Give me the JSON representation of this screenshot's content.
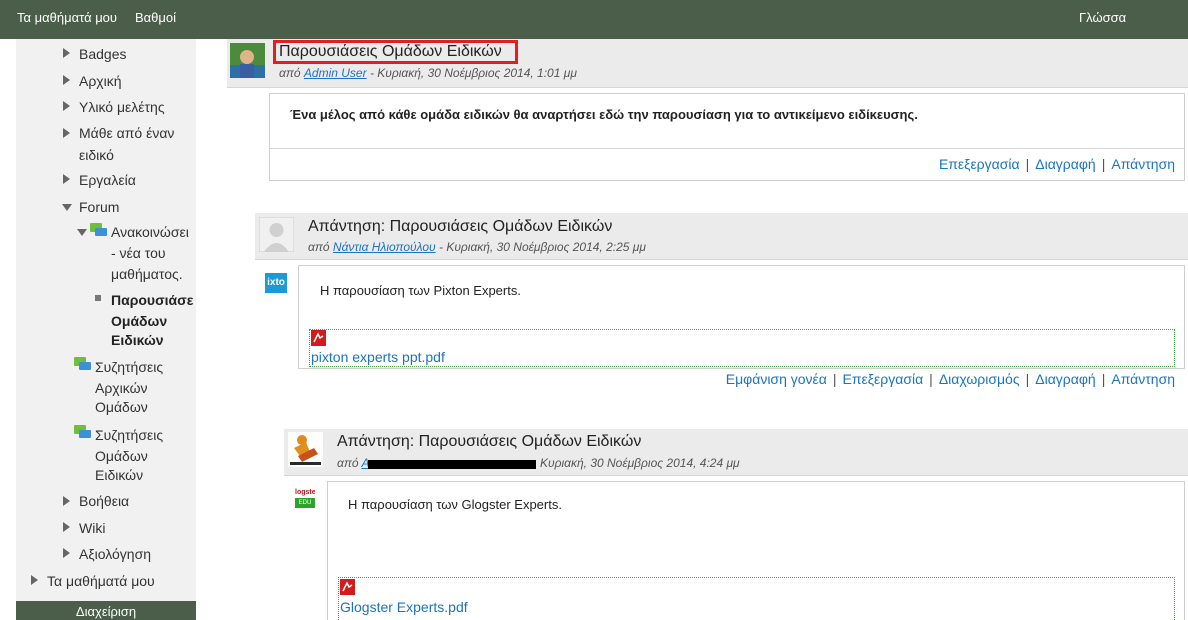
{
  "topnav": {
    "my_courses": "Τα μαθήματά μου",
    "grades": "Βαθμοί",
    "language": "Γλώσσα"
  },
  "sidebar": {
    "items": [
      {
        "label": "Badges"
      },
      {
        "label": "Αρχική"
      },
      {
        "label": "Υλικό μελέτης"
      },
      {
        "label_line1": "Μάθε από έναν",
        "label_line2": "ειδικό"
      },
      {
        "label": "Εργαλεία"
      },
      {
        "label": "Forum"
      }
    ],
    "forum_children": {
      "announcements_line1": "Ανακοινώσει",
      "announcements_line2": "- νέα του",
      "announcements_line3": "μαθήματος.",
      "current_line1": "Παρουσιάσε",
      "current_line2": "Ομάδων",
      "current_line3": "Ειδικών",
      "discussions_initial_line1": "Συζητήσεις",
      "discussions_initial_line2": "Αρχικών",
      "discussions_initial_line3": "Ομάδων",
      "discussions_expert_line1": "Συζητήσεις",
      "discussions_expert_line2": "Ομάδων",
      "discussions_expert_line3": "Ειδικών"
    },
    "bottom_items": [
      {
        "label": "Βοήθεια"
      },
      {
        "label": "Wiki"
      },
      {
        "label": "Αξιολόγηση"
      }
    ],
    "my_courses": "Τα μαθήματά μου",
    "admin": "Διαχείριση"
  },
  "posts": [
    {
      "title": "Παρουσιάσεις Ομάδων Ειδικών",
      "meta_prefix": "από",
      "author": "Admin User",
      "meta_date": "- Κυριακή, 30 Νοέμβριος 2014, 1:01 μμ",
      "body": "Ένα μέλος από κάθε ομάδα ειδικών  θα αναρτήσει εδώ την παρουσίαση για το αντικείμενο ειδίκευσης.",
      "commands": [
        "Επεξεργασία",
        "Διαγραφή",
        "Απάντηση"
      ]
    },
    {
      "title": "Απάντηση: Παρουσιάσεις Ομάδων Ειδικών",
      "meta_prefix": "από",
      "author": "Νάντια Ηλιοπούλου",
      "meta_date": "- Κυριακή, 30 Νοέμβριος 2014, 2:25 μμ",
      "body": "Η παρουσίαση των Pixton Experts.",
      "attachment": "pixton experts ppt.pdf",
      "logo_text": "ixto",
      "commands": [
        "Εμφάνιση γονέα",
        "Επεξεργασία",
        "Διαχωρισμός",
        "Διαγραφή",
        "Απάντηση"
      ]
    },
    {
      "title": "Απάντηση: Παρουσιάσεις Ομάδων Ειδικών",
      "meta_prefix": "από",
      "author": "Α",
      "meta_date": "Κυριακή, 30 Νοέμβριος 2014, 4:24 μμ",
      "body": "Η παρουσίαση των Glogster Experts.",
      "attachment": "Glogster Experts.pdf",
      "logo_text_top": "logste",
      "logo_text_bottom": "EDU"
    }
  ],
  "colors": {
    "topbar": "#4a5e4a",
    "link": "#1a74c0",
    "highlight_box": "#e02020",
    "attachment_border": "#3aa83a"
  }
}
